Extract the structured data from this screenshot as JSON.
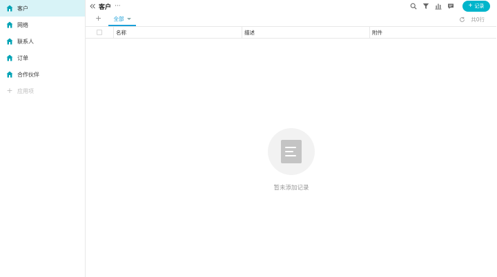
{
  "sidebar": {
    "items": [
      {
        "label": "客户",
        "active": true
      },
      {
        "label": "网络",
        "active": false
      },
      {
        "label": "联系人",
        "active": false
      },
      {
        "label": "订单",
        "active": false
      },
      {
        "label": "合作伙伴",
        "active": false
      }
    ],
    "add_label": "应用项"
  },
  "header": {
    "title": "客户",
    "more": "···",
    "record_button": "记录"
  },
  "tabs": {
    "all_label": "全部",
    "count": "共0行"
  },
  "table": {
    "columns": [
      "名称",
      "描述",
      "附件"
    ]
  },
  "empty": {
    "message": "暂未添加记录"
  },
  "colors": {
    "accent": "#00b5cb",
    "tab_active": "#1a9fd8",
    "sidebar_active_bg": "#d8f3f7",
    "app_icon": "#00a3b5"
  }
}
